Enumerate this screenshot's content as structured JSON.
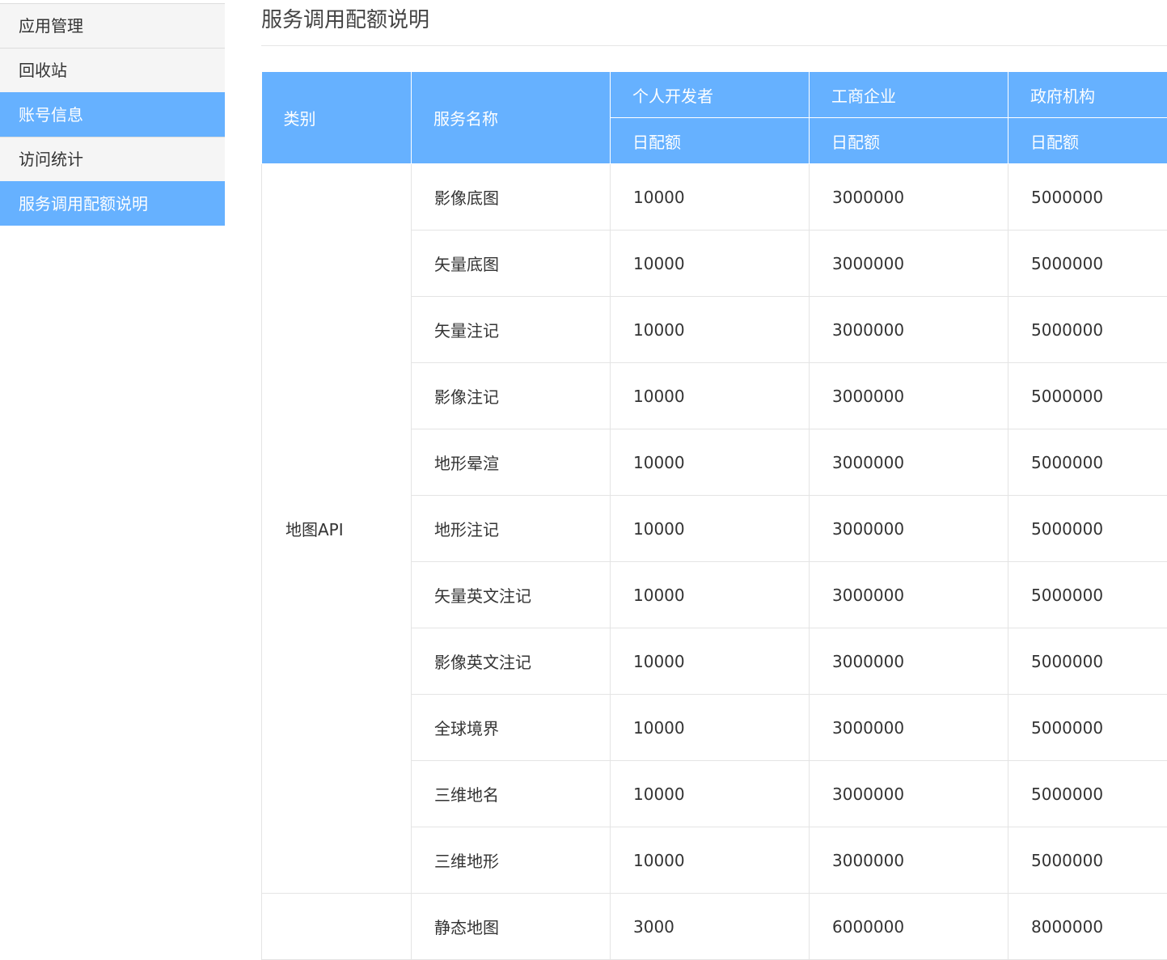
{
  "sidebar": {
    "items": [
      {
        "label": "应用管理",
        "active": false
      },
      {
        "label": "回收站",
        "active": false
      },
      {
        "label": "账号信息",
        "active": true
      },
      {
        "label": "访问统计",
        "active": false
      },
      {
        "label": "服务调用配额说明",
        "active": true
      }
    ]
  },
  "page": {
    "title": "服务调用配额说明"
  },
  "table": {
    "headers": {
      "category": "类别",
      "service": "服务名称",
      "personal": "个人开发者",
      "enterprise": "工商企业",
      "government": "政府机构",
      "daily_quota": "日配额"
    },
    "groups": [
      {
        "category": "地图API",
        "rows": [
          {
            "service": "影像底图",
            "personal": "10000",
            "enterprise": "3000000",
            "government": "5000000"
          },
          {
            "service": "矢量底图",
            "personal": "10000",
            "enterprise": "3000000",
            "government": "5000000"
          },
          {
            "service": "矢量注记",
            "personal": "10000",
            "enterprise": "3000000",
            "government": "5000000"
          },
          {
            "service": "影像注记",
            "personal": "10000",
            "enterprise": "3000000",
            "government": "5000000"
          },
          {
            "service": "地形晕渲",
            "personal": "10000",
            "enterprise": "3000000",
            "government": "5000000"
          },
          {
            "service": "地形注记",
            "personal": "10000",
            "enterprise": "3000000",
            "government": "5000000"
          },
          {
            "service": "矢量英文注记",
            "personal": "10000",
            "enterprise": "3000000",
            "government": "5000000"
          },
          {
            "service": "影像英文注记",
            "personal": "10000",
            "enterprise": "3000000",
            "government": "5000000"
          },
          {
            "service": "全球境界",
            "personal": "10000",
            "enterprise": "3000000",
            "government": "5000000"
          },
          {
            "service": "三维地名",
            "personal": "10000",
            "enterprise": "3000000",
            "government": "5000000"
          },
          {
            "service": "三维地形",
            "personal": "10000",
            "enterprise": "3000000",
            "government": "5000000"
          }
        ]
      },
      {
        "category": "",
        "rows": [
          {
            "service": "静态地图",
            "personal": "3000",
            "enterprise": "6000000",
            "government": "8000000"
          }
        ]
      }
    ]
  },
  "colors": {
    "accent": "#66b1ff",
    "sidebar_bg": "#f5f5f5",
    "border": "#e4e4e4"
  }
}
